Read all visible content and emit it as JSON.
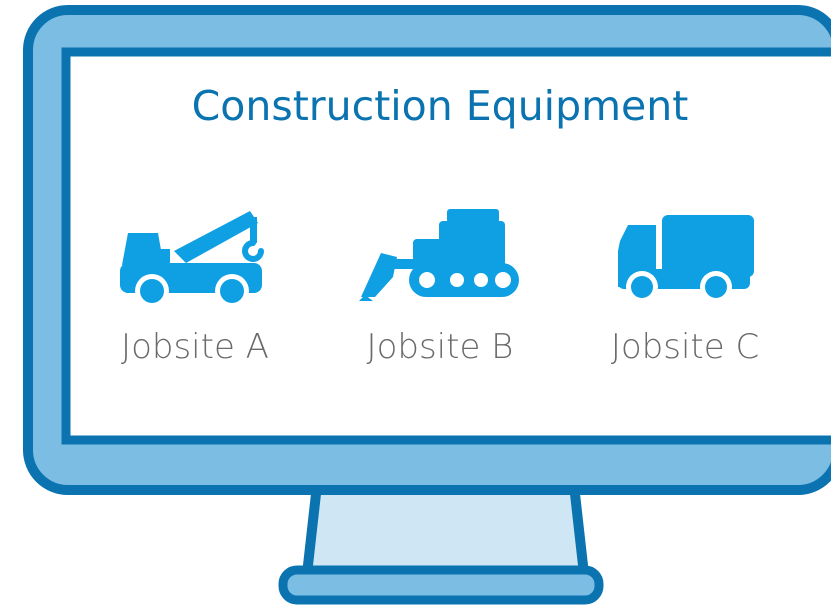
{
  "screen": {
    "title": "Construction Equipment"
  },
  "jobsites": [
    {
      "label": "Jobsite A",
      "icon": "tow-truck-icon"
    },
    {
      "label": "Jobsite B",
      "icon": "bulldozer-icon"
    },
    {
      "label": "Jobsite C",
      "icon": "box-truck-icon"
    }
  ],
  "colors": {
    "bezel": "#7bbde3",
    "outline": "#0a73b0",
    "icon": "#0ea0e3",
    "stand": "#cfe6f4",
    "label": "#6a6a6a"
  }
}
